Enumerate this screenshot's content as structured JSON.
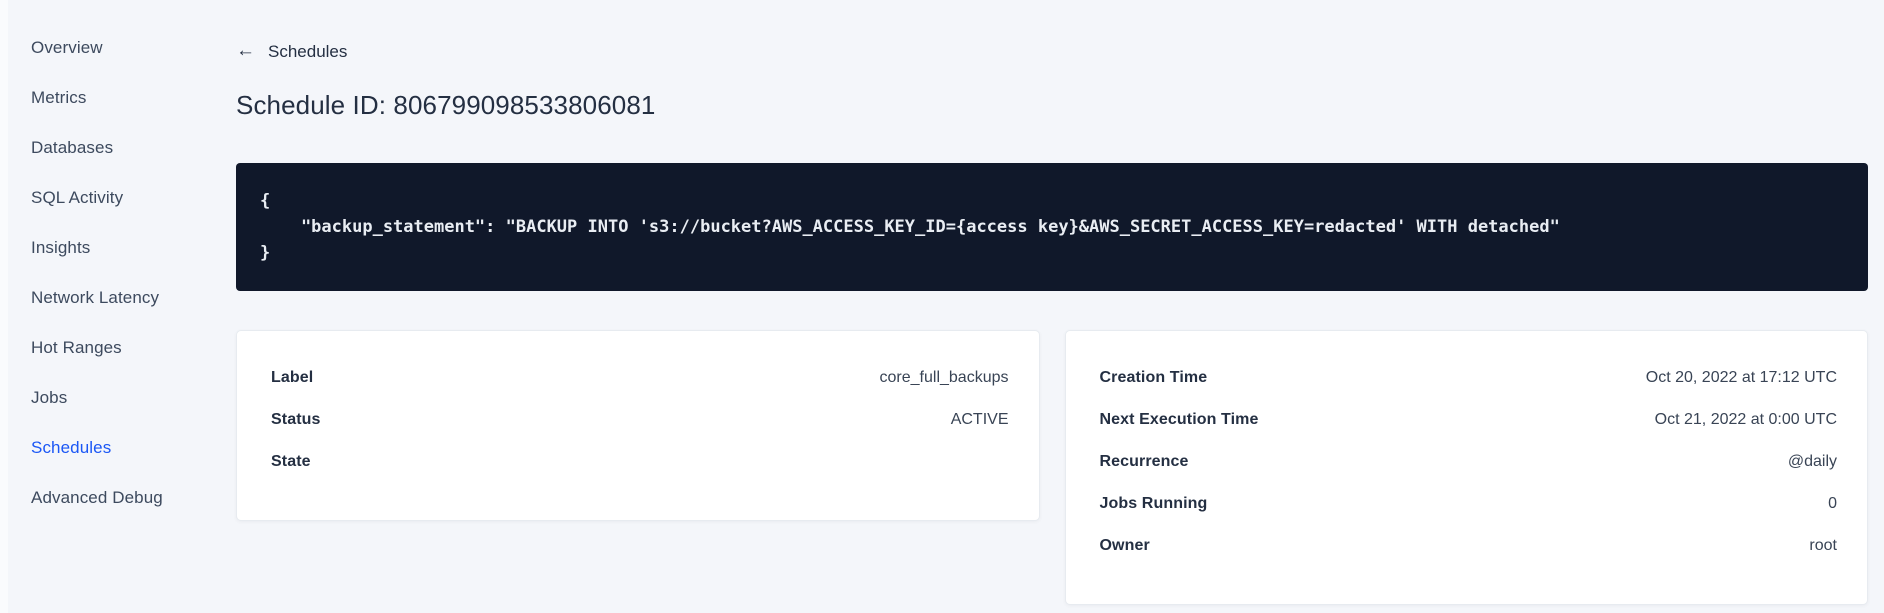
{
  "sidebar": {
    "items": [
      {
        "label": "Overview",
        "active": false
      },
      {
        "label": "Metrics",
        "active": false
      },
      {
        "label": "Databases",
        "active": false
      },
      {
        "label": "SQL Activity",
        "active": false
      },
      {
        "label": "Insights",
        "active": false
      },
      {
        "label": "Network Latency",
        "active": false
      },
      {
        "label": "Hot Ranges",
        "active": false
      },
      {
        "label": "Jobs",
        "active": false
      },
      {
        "label": "Schedules",
        "active": true
      },
      {
        "label": "Advanced Debug",
        "active": false
      }
    ]
  },
  "header": {
    "back_arrow": "←",
    "back_label": "Schedules",
    "title": "Schedule ID: 806799098533806081"
  },
  "code": {
    "lines": [
      "{",
      "    \"backup_statement\": \"BACKUP INTO 's3://bucket?AWS_ACCESS_KEY_ID={access key}&AWS_SECRET_ACCESS_KEY=redacted' WITH detached\"",
      "}"
    ]
  },
  "details_card": {
    "rows": [
      {
        "label": "Label",
        "value": "core_full_backups"
      },
      {
        "label": "Status",
        "value": "ACTIVE"
      },
      {
        "label": "State",
        "value": ""
      }
    ]
  },
  "schedule_card": {
    "rows": [
      {
        "label": "Creation Time",
        "value": "Oct 20, 2022 at 17:12 UTC"
      },
      {
        "label": "Next Execution Time",
        "value": "Oct 21, 2022 at 0:00 UTC"
      },
      {
        "label": "Recurrence",
        "value": "@daily"
      },
      {
        "label": "Jobs Running",
        "value": "0"
      },
      {
        "label": "Owner",
        "value": "root"
      }
    ]
  },
  "colors": {
    "accent_blue": "#1b57f5",
    "sidebar_text": "#3d4a5e",
    "heading_text": "#242f42",
    "code_background": "#10182a",
    "code_text": "#e9edf3",
    "page_background": "#f4f6fa",
    "card_background": "#ffffff"
  }
}
